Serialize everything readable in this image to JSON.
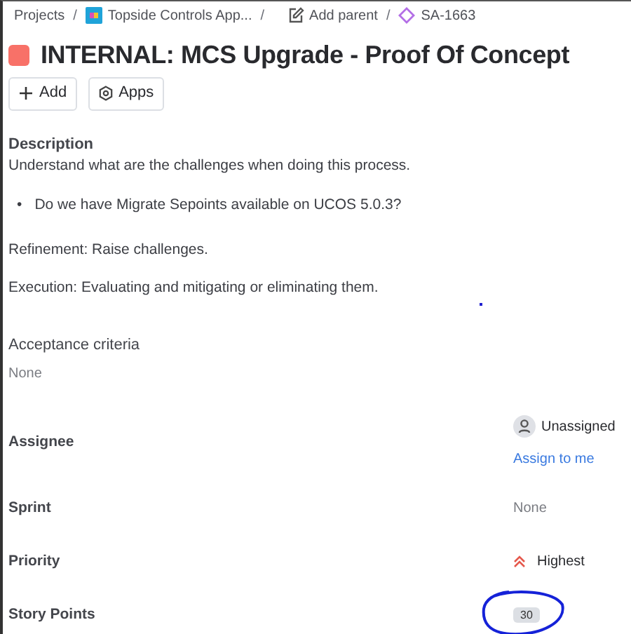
{
  "breadcrumbs": [
    {
      "kind": "text",
      "label": "Projects"
    },
    {
      "kind": "separator",
      "label": "/"
    },
    {
      "kind": "project",
      "label": "Topside Controls App..."
    },
    {
      "kind": "separator",
      "label": "/"
    },
    {
      "kind": "parent",
      "label": "Add parent"
    },
    {
      "kind": "separator",
      "label": "/"
    },
    {
      "kind": "issue",
      "label": "SA-1663"
    }
  ],
  "title": "INTERNAL: MCS Upgrade - Proof Of Concept",
  "buttons": [
    {
      "kind": "add",
      "label": "Add"
    },
    {
      "kind": "apps",
      "label": "Apps"
    }
  ],
  "description": {
    "heading": "Description",
    "paragraphs": [
      {
        "kind": "text",
        "text": "Understand what are the challenges when doing this process."
      },
      {
        "kind": "bullet",
        "marker": "•",
        "text": "Do we have Migrate Sepoints available on UCOS 5.0.3?"
      },
      {
        "kind": "text",
        "text": "Refinement: Raise challenges."
      },
      {
        "kind": "text",
        "text": "Execution: Evaluating and mitigating or eliminating them."
      }
    ]
  },
  "acceptance_criteria": {
    "heading": "Acceptance criteria",
    "value": "None"
  },
  "fields": [
    {
      "kind": "assignee",
      "label": "Assignee",
      "value": "Unassigned",
      "action": "Assign to me"
    },
    {
      "kind": "text",
      "label": "Sprint",
      "value": "None"
    },
    {
      "kind": "priority",
      "label": "Priority",
      "value": "Highest"
    },
    {
      "kind": "badge",
      "label": "Story Points",
      "value": "30"
    }
  ]
}
